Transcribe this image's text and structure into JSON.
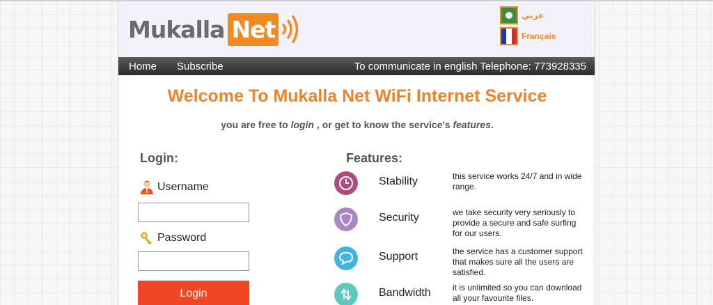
{
  "header": {
    "logo_text": "Mukalla",
    "logo_box_text": "Net",
    "languages": [
      {
        "label": "عربي",
        "flag_colors": [
          "#3e8d3a",
          "#f1f1f1"
        ]
      },
      {
        "label": "Français",
        "flag_colors": [
          "#1b3ba1",
          "#ffffff",
          "#e0262c"
        ]
      }
    ]
  },
  "nav": {
    "home": "Home",
    "subscribe": "Subscribe",
    "phone_text": "To communicate in english Telephone: 773928335"
  },
  "main": {
    "welcome": "Welcome To Mukalla Net WiFi Internet Service",
    "sub_pre": "you are free to",
    "sub_login": "login",
    "sub_mid": ", or get to know the service's",
    "sub_features": "features",
    "sub_end": "."
  },
  "login": {
    "title": "Login:",
    "username_label": "Username",
    "username_value": "",
    "password_label": "Password",
    "password_value": "",
    "button": "Login"
  },
  "features": {
    "title": "Features:",
    "items": [
      {
        "name": "Stability",
        "desc": "this service works 24/7 and in wide range.",
        "icon": "clock-icon",
        "color": "#b04b7e"
      },
      {
        "name": "Security",
        "desc": "we take security very seriously to provide a secure and safe surfing for our users.",
        "icon": "shield-icon",
        "color": "#a887c4"
      },
      {
        "name": "Support",
        "desc": "the service has a customer support that makes sure all the users are satisfied.",
        "icon": "chat-bubble-icon",
        "color": "#3fb5e0"
      },
      {
        "name": "Bandwidth",
        "desc": "it is unlimited so you can download all your favourite files.",
        "icon": "transfer-arrows-icon",
        "color": "#5cc8c0"
      }
    ]
  },
  "colors": {
    "accent": "#f0832a",
    "login_button": "#ef4623",
    "nav_bar": "#3a3a3a"
  }
}
